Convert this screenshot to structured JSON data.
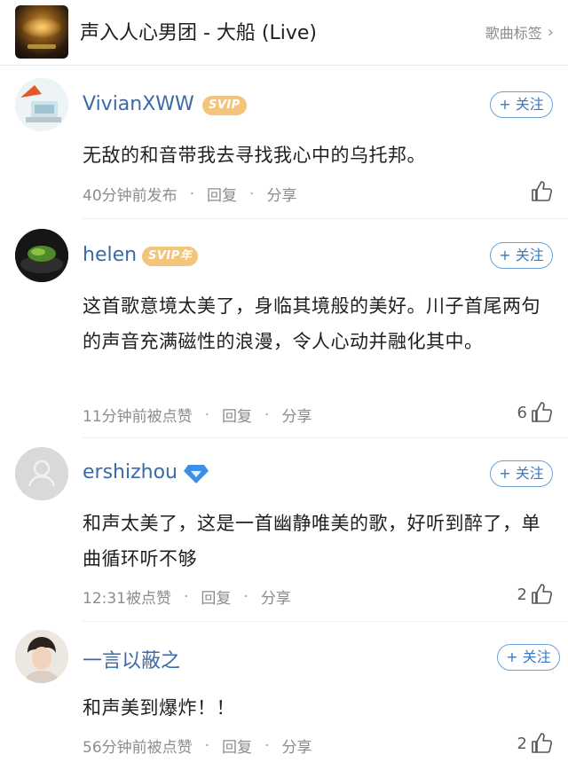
{
  "header": {
    "song_title": "声入人心男团 - 大船 (Live)",
    "tag_link": "歌曲标签",
    "chevron_icon": "chevron-right-icon"
  },
  "follow_label": "+ 关注",
  "actions": {
    "reply": "回复",
    "share": "分享"
  },
  "comments": [
    {
      "username": "VivianXWW",
      "badge": "SVIP",
      "text": "无敌的和音带我去寻找我心中的乌托邦。",
      "time": "40分钟前发布",
      "likes": ""
    },
    {
      "username": "helen",
      "badge": "SVIP年",
      "text": "这首歌意境太美了，身临其境般的美好。川子首尾两句的声音充满磁性的浪漫，令人心动并融化其中。",
      "time": "11分钟前被点赞",
      "likes": "6"
    },
    {
      "username": "ershizhou",
      "badge_icon": "diamond-icon",
      "text": "和声太美了，这是一首幽静唯美的歌，好听到醉了，单曲循环听不够",
      "time": "12:31被点赞",
      "likes": "2"
    },
    {
      "username": "一言以蔽之",
      "text": "和声美到爆炸！！",
      "time": "56分钟前被点赞",
      "likes": "2"
    }
  ],
  "colors": {
    "username": "#3a6aa8",
    "follow": "#3a78c3",
    "badge": "#f3c57a",
    "diamond": "#3d8fe6"
  }
}
